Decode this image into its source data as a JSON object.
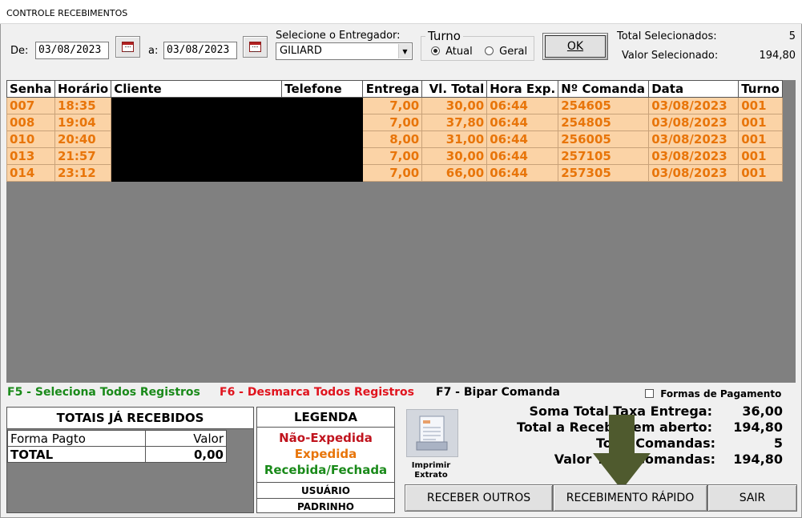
{
  "window": {
    "title": "CONTROLE RECEBIMENTOS"
  },
  "filters": {
    "from_label": "De:",
    "from_date": "03/08/2023",
    "to_label": "a:",
    "to_date": "03/08/2023",
    "deliverer_label": "Selecione o Entregador:",
    "deliverer_value": "GILIARD",
    "turno_label": "Turno",
    "turno_options": [
      "Atual",
      "Geral"
    ],
    "turno_selected": "Atual",
    "ok_label": "OK"
  },
  "totals_top": {
    "selected_count_label": "Total Selecionados:",
    "selected_count": "5",
    "selected_value_label": "Valor Selecionado:",
    "selected_value": "194,80"
  },
  "grid": {
    "columns": [
      "Senha",
      "Horário",
      "Cliente",
      "Telefone",
      "Entrega",
      "Vl. Total",
      "Hora Exp.",
      "Nº Comanda",
      "Data",
      "Turno"
    ],
    "rows": [
      [
        "007",
        "18:35",
        "",
        "",
        "7,00",
        "30,00",
        "06:44",
        "254605",
        "03/08/2023",
        "001"
      ],
      [
        "008",
        "19:04",
        "",
        "",
        "7,00",
        "37,80",
        "06:44",
        "254805",
        "03/08/2023",
        "001"
      ],
      [
        "010",
        "20:40",
        "",
        "",
        "8,00",
        "31,00",
        "06:44",
        "256005",
        "03/08/2023",
        "001"
      ],
      [
        "013",
        "21:57",
        "",
        "",
        "7,00",
        "30,00",
        "06:44",
        "257105",
        "03/08/2023",
        "001"
      ],
      [
        "014",
        "23:12",
        "",
        "",
        "7,00",
        "66,00",
        "06:44",
        "257305",
        "03/08/2023",
        "001"
      ]
    ],
    "row_color": "#fbd3a6",
    "row_text_color": "#e8750a"
  },
  "hotkeys": {
    "f5": "F5 - Seleciona Todos Registros",
    "f6": "F6 - Desmarca Todos Registros",
    "f7": "F7 - Bipar Comanda",
    "f5_color": "#1a8a1a",
    "f6_color": "#e0141e"
  },
  "formas_pagamento_label": "Formas de Pagamento",
  "totais_recebidos": {
    "title": "TOTAIS JÁ RECEBIDOS",
    "col_forma": "Forma Pagto",
    "col_valor": "Valor",
    "total_label": "TOTAL",
    "total_value": "0,00"
  },
  "legenda": {
    "title": "LEGENDA",
    "nao_expedida": "Não-Expedida",
    "expedida": "Expedida",
    "recebida": "Recebida/Fechada",
    "usuario": "USUÁRIO",
    "padrinho": "PADRINHO"
  },
  "imprimir": {
    "label_line1": "Imprimir",
    "label_line2": "Extrato"
  },
  "summary": {
    "taxa_label": "Soma Total Taxa Entrega:",
    "taxa_value": "36,00",
    "aberto_label": "Total a Receber em aberto:",
    "aberto_value": "194,80",
    "comandas_label": "Total Comandas:",
    "comandas_value": "5",
    "valor_label": "Valor Total Comandas:",
    "valor_value": "194,80"
  },
  "buttons": {
    "receber_outros": "RECEBER OUTROS",
    "recebimento_rapido": "RECEBIMENTO RÁPIDO",
    "sair": "SAIR"
  },
  "annotation": {
    "arrow_color": "#4f5a2e",
    "icon": "down-arrow-icon"
  }
}
